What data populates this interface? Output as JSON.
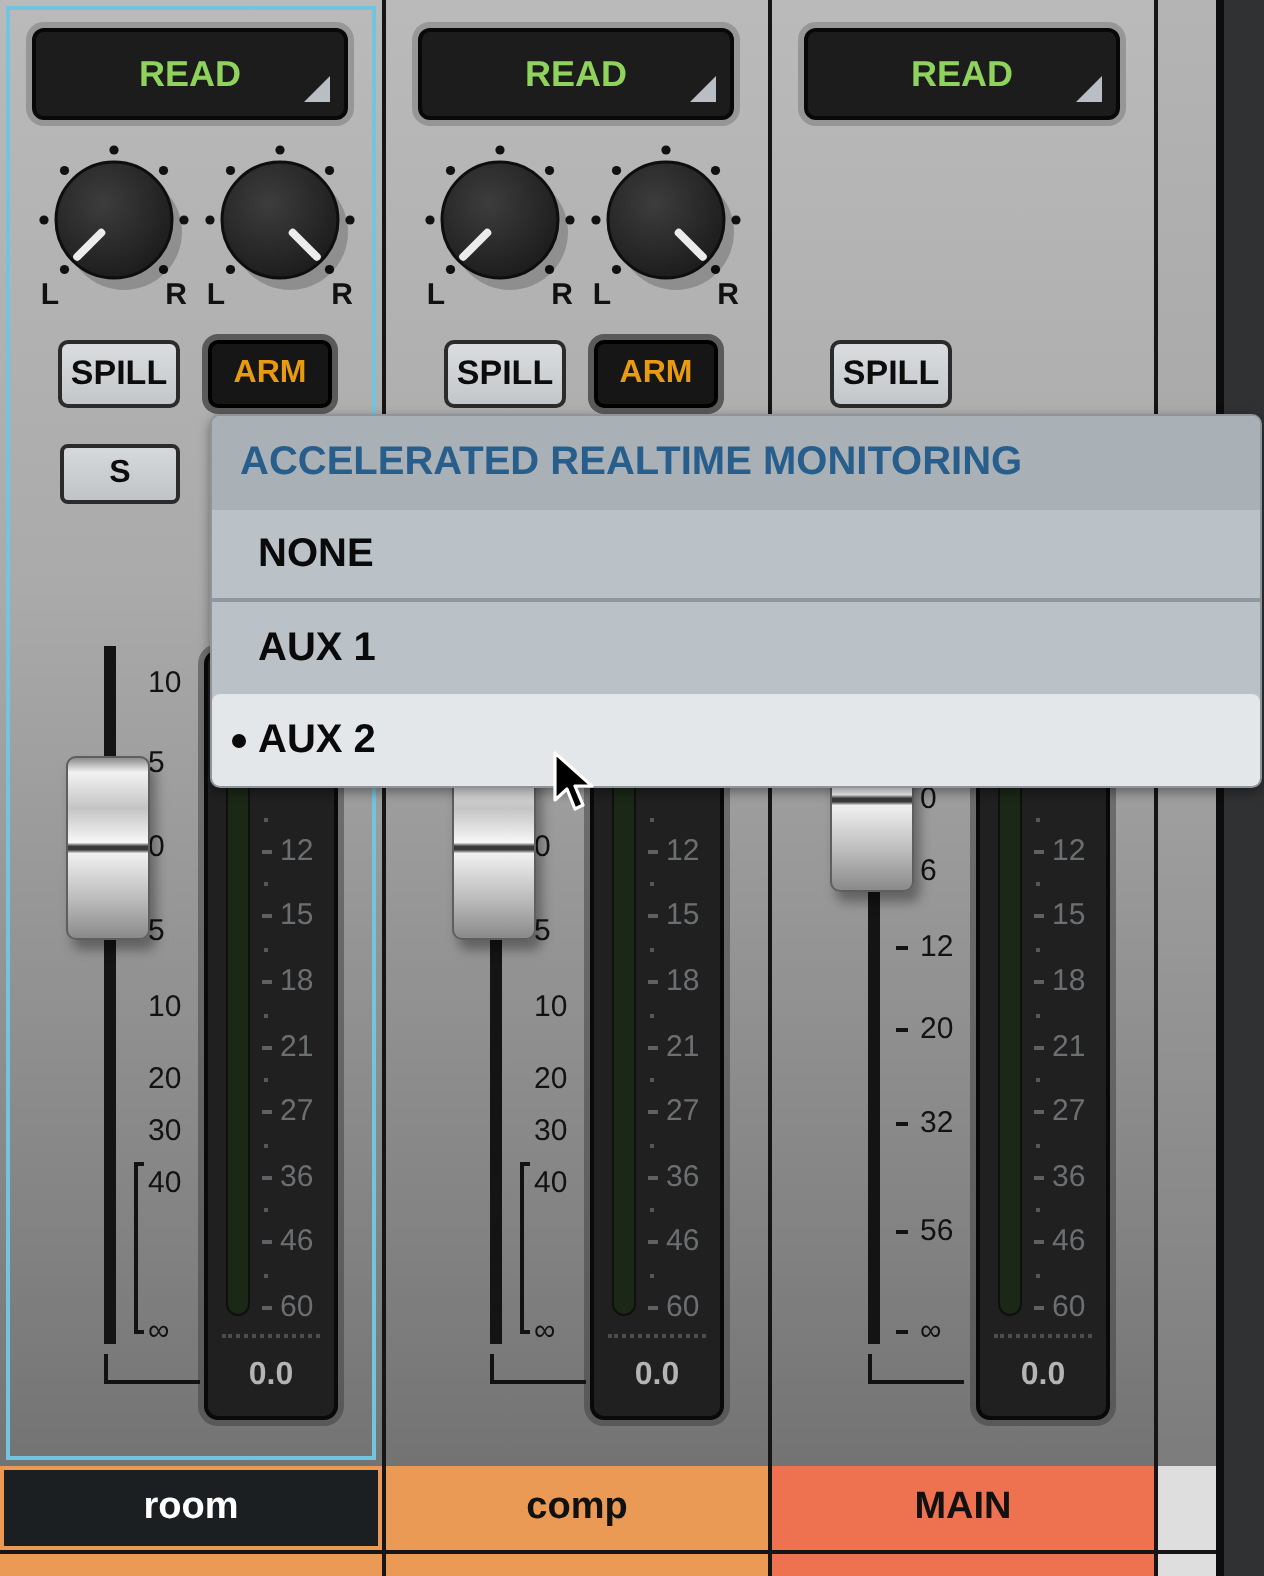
{
  "strips": [
    {
      "name": "room",
      "kind": "track",
      "selected": true,
      "color": "#eb9a55",
      "automation": "READ",
      "knobs": [
        {
          "kind": "left",
          "left_label": "L",
          "right_label": "R"
        },
        {
          "kind": "right",
          "left_label": "L",
          "right_label": "R"
        }
      ],
      "buttons": [
        {
          "kind": "spill",
          "label": "SPILL"
        },
        {
          "kind": "arm",
          "label": "ARM"
        },
        {
          "kind": "solo",
          "label": "S"
        }
      ],
      "fader": {
        "level": 0.71,
        "scale": [
          "10",
          "5",
          "0",
          "5",
          "10",
          "20",
          "30",
          "40",
          "∞"
        ]
      },
      "meter": {
        "scale": [
          "12",
          "15",
          "18",
          "21",
          "27",
          "36",
          "46",
          "60"
        ],
        "reading": "0.0"
      }
    },
    {
      "name": "comp",
      "kind": "track",
      "selected": false,
      "color": "#eb9a55",
      "automation": "READ",
      "knobs": [
        {
          "kind": "left",
          "left_label": "L",
          "right_label": "R"
        },
        {
          "kind": "right",
          "left_label": "L",
          "right_label": "R"
        }
      ],
      "buttons": [
        {
          "kind": "spill",
          "label": "SPILL"
        },
        {
          "kind": "arm",
          "label": "ARM"
        }
      ],
      "fader": {
        "level": 0.71,
        "scale": [
          "0",
          "5",
          "10",
          "20",
          "30",
          "40",
          "∞"
        ]
      },
      "meter": {
        "scale": [
          "12",
          "15",
          "18",
          "21",
          "27",
          "36",
          "46",
          "60"
        ],
        "reading": "0.0"
      }
    },
    {
      "name": "MAIN",
      "kind": "master",
      "selected": false,
      "color": "#ee7150",
      "automation": "READ",
      "buttons": [
        {
          "kind": "spill",
          "label": "SPILL"
        }
      ],
      "fader": {
        "level": 0.78,
        "scale": [
          "0",
          "6",
          "12",
          "20",
          "32",
          "56",
          "∞"
        ]
      },
      "meter": {
        "scale": [
          "12",
          "15",
          "18",
          "21",
          "27",
          "36",
          "46",
          "60"
        ],
        "reading": "0.0"
      }
    }
  ],
  "menu": {
    "title": "ACCELERATED REALTIME MONITORING",
    "items": [
      {
        "label": "NONE",
        "checked": false,
        "selected": false
      },
      {
        "label": "AUX 1",
        "checked": false,
        "selected": false
      },
      {
        "label": "AUX 2",
        "checked": true,
        "selected": true
      }
    ]
  }
}
